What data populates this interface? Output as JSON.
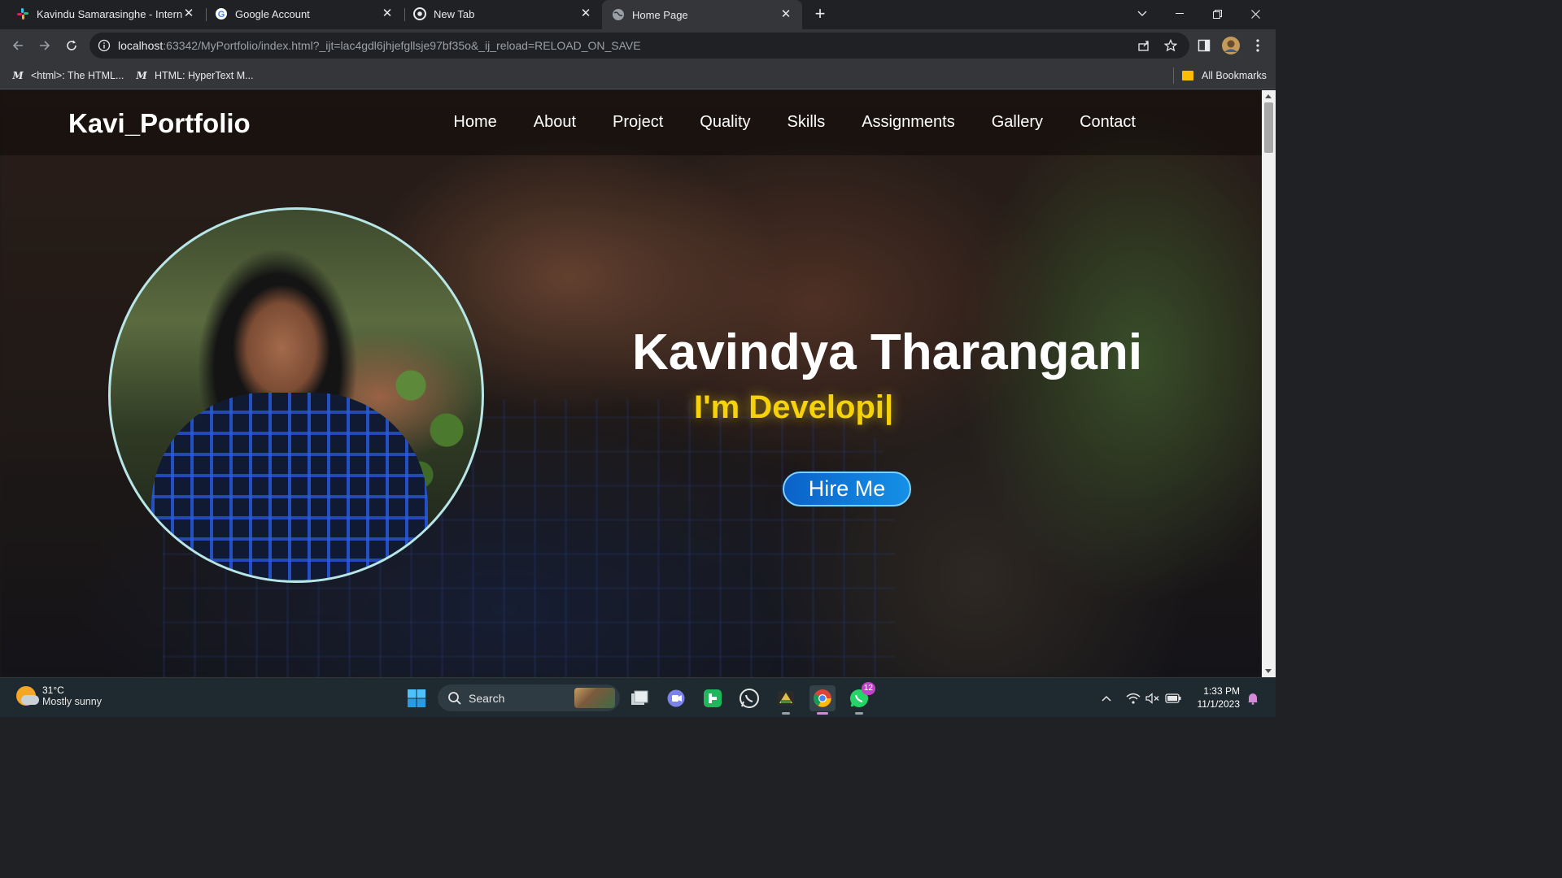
{
  "browser": {
    "tabs": [
      {
        "title": "Kavindu Samarasinghe - Interne",
        "icon": "slack-icon",
        "active": false
      },
      {
        "title": "Google Account",
        "icon": "google-icon",
        "active": false
      },
      {
        "title": "New Tab",
        "icon": "chrome-icon",
        "active": false
      },
      {
        "title": "Home Page",
        "icon": "globe-icon",
        "active": true
      }
    ],
    "url_host": "localhost",
    "url_rest": ":63342/MyPortfolio/index.html?_ijt=lac4gdl6jhjefgllsje97bf35o&_ij_reload=RELOAD_ON_SAVE",
    "bookmarks": [
      {
        "label": "<html>: The HTML...",
        "icon": "mdn-icon"
      },
      {
        "label": "HTML: HyperText M...",
        "icon": "mdn-icon"
      }
    ],
    "all_bookmarks_label": "All Bookmarks"
  },
  "page": {
    "logo": "Kavi_Portfolio",
    "nav": [
      "Home",
      "About",
      "Project",
      "Quality",
      "Skills",
      "Assignments",
      "Gallery",
      "Contact"
    ],
    "name": "Kavindya Tharangani",
    "role_text": "I'm Developi|",
    "hire_button": "Hire Me",
    "colors": {
      "accent_yellow": "#f5d20a",
      "button_blue": "#1590e6",
      "photo_border": "#b8e6e6"
    }
  },
  "taskbar": {
    "weather_temp": "31°C",
    "weather_cond": "Mostly sunny",
    "search_label": "Search",
    "whatsapp_badge": "12",
    "time": "1:33 PM",
    "date": "11/1/2023"
  }
}
